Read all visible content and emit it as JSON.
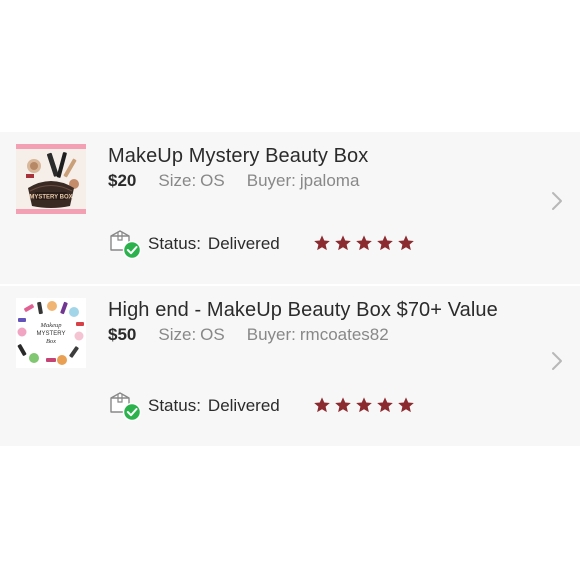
{
  "orders": [
    {
      "title": "MakeUp Mystery Beauty Box",
      "price": "$20",
      "size_label": "Size:",
      "size_value": "OS",
      "buyer_label": "Buyer:",
      "buyer_value": "jpaloma",
      "status_label": "Status:",
      "status_value": "Delivered",
      "rating": 5,
      "thumb_text": "MYSTERY BOX",
      "thumb_colors": {
        "frame": "#f3a0b4",
        "bag": "#3a2a24",
        "accent": "#e8c9a9"
      }
    },
    {
      "title": "High end - MakeUp Beauty Box $70+ Value",
      "price": "$50",
      "size_label": "Size:",
      "size_value": "OS",
      "buyer_label": "Buyer:",
      "buyer_value": "rmcoates82",
      "status_label": "Status:",
      "status_value": "Delivered",
      "rating": 5,
      "thumb_text": "Makeup MYSTERY Box",
      "thumb_colors": {
        "bg": "#ffffff",
        "text": "#333333"
      }
    }
  ],
  "colors": {
    "star": "#8b2a2f",
    "check": "#2bb24c",
    "chevron": "#b8b8b8",
    "card_bg": "#f7f7f7"
  },
  "icons": {
    "delivered": "package-check-icon",
    "rating_star": "star-icon",
    "row_arrow": "chevron-right-icon"
  }
}
